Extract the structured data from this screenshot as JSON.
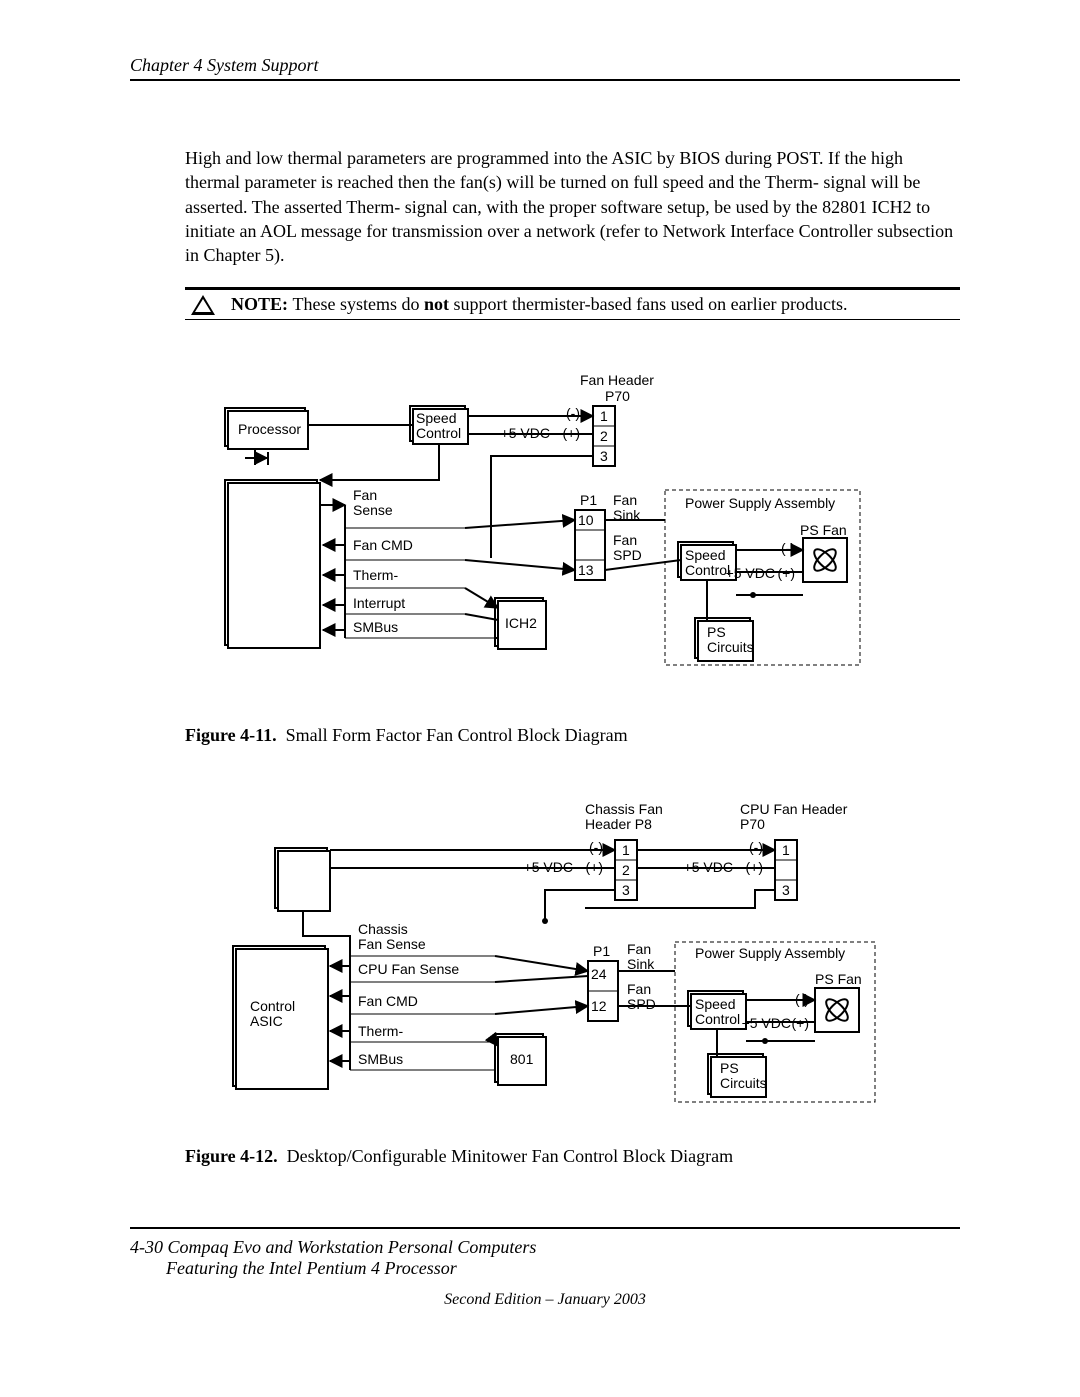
{
  "chapter_header": "Chapter 4  System Support",
  "body_paragraph": "High and low thermal parameters are programmed into the ASIC by BIOS during POST. If the high thermal parameter is reached then the fan(s) will be turned on full speed and the Therm- signal will be asserted. The asserted Therm- signal can, with the proper software setup, be used by the 82801 ICH2 to initiate an AOL message for transmission over a network (refer to Network Interface Controller subsection in Chapter 5).",
  "note": {
    "label": "NOTE:",
    "pre": "These systems do ",
    "bold": "not",
    "post": " support thermister-based fans used on earlier products."
  },
  "diagram1": {
    "fan_header": "Fan Header",
    "p70": "P70",
    "processor": "Processor",
    "speed_control": "Speed\nControl",
    "plus5": "+5 VDC",
    "minus": "(-)",
    "plus": "(+)",
    "pins_p70": [
      "1",
      "2",
      "3"
    ],
    "fan_sense": "Fan\nSense",
    "p1": "P1",
    "fan_sink": "Fan\nSink",
    "fan_cmd": "Fan CMD",
    "pin10": "10",
    "pin13": "13",
    "fan_spd": "Fan\nSPD",
    "therm": "Therm-",
    "interrupt": "Interrupt",
    "smbus": "SMBus",
    "ich2": "ICH2",
    "ps_assembly": "Power Supply Assembly",
    "ps_fan": "PS Fan",
    "ps_circuits": "PS\nCircuits",
    "speed_ctrl_ps": "Speed\nControl"
  },
  "fig1": {
    "num": "Figure 4-11.",
    "title": "Small Form Factor Fan Control Block Diagram"
  },
  "diagram2": {
    "chassis_header": "Chassis Fan\nHeader P8",
    "cpu_header": "CPU Fan Header\nP70",
    "minus": "(-)",
    "plus": "(+)",
    "plus5": "+5 VDC",
    "pins": [
      "1",
      "2",
      "3"
    ],
    "control_asic": "Control\nASIC",
    "chassis_fan_sense": "Chassis\nFan Sense",
    "cpu_fan_sense": "CPU Fan Sense",
    "fan_cmd": "Fan CMD",
    "therm": "Therm-",
    "smbus": "SMBus",
    "chip": "801",
    "p1": "P1",
    "pin24": "24",
    "pin12": "12",
    "fan_sink": "Fan\nSink",
    "fan_spd": "Fan\nSPD",
    "ps_assembly": "Power Supply Assembly",
    "ps_fan": "PS Fan",
    "speed_ctrl_ps": "Speed\nControl",
    "ps_circuits": "PS\nCircuits"
  },
  "fig2": {
    "num": "Figure 4-12.",
    "title": "Desktop/Configurable Minitower Fan Control Block Diagram"
  },
  "footer": {
    "page": "4-30",
    "title": "Compaq Evo and Workstation Personal Computers",
    "sub": "Featuring the Intel Pentium 4 Processor",
    "edition": "Second Edition – January 2003"
  }
}
